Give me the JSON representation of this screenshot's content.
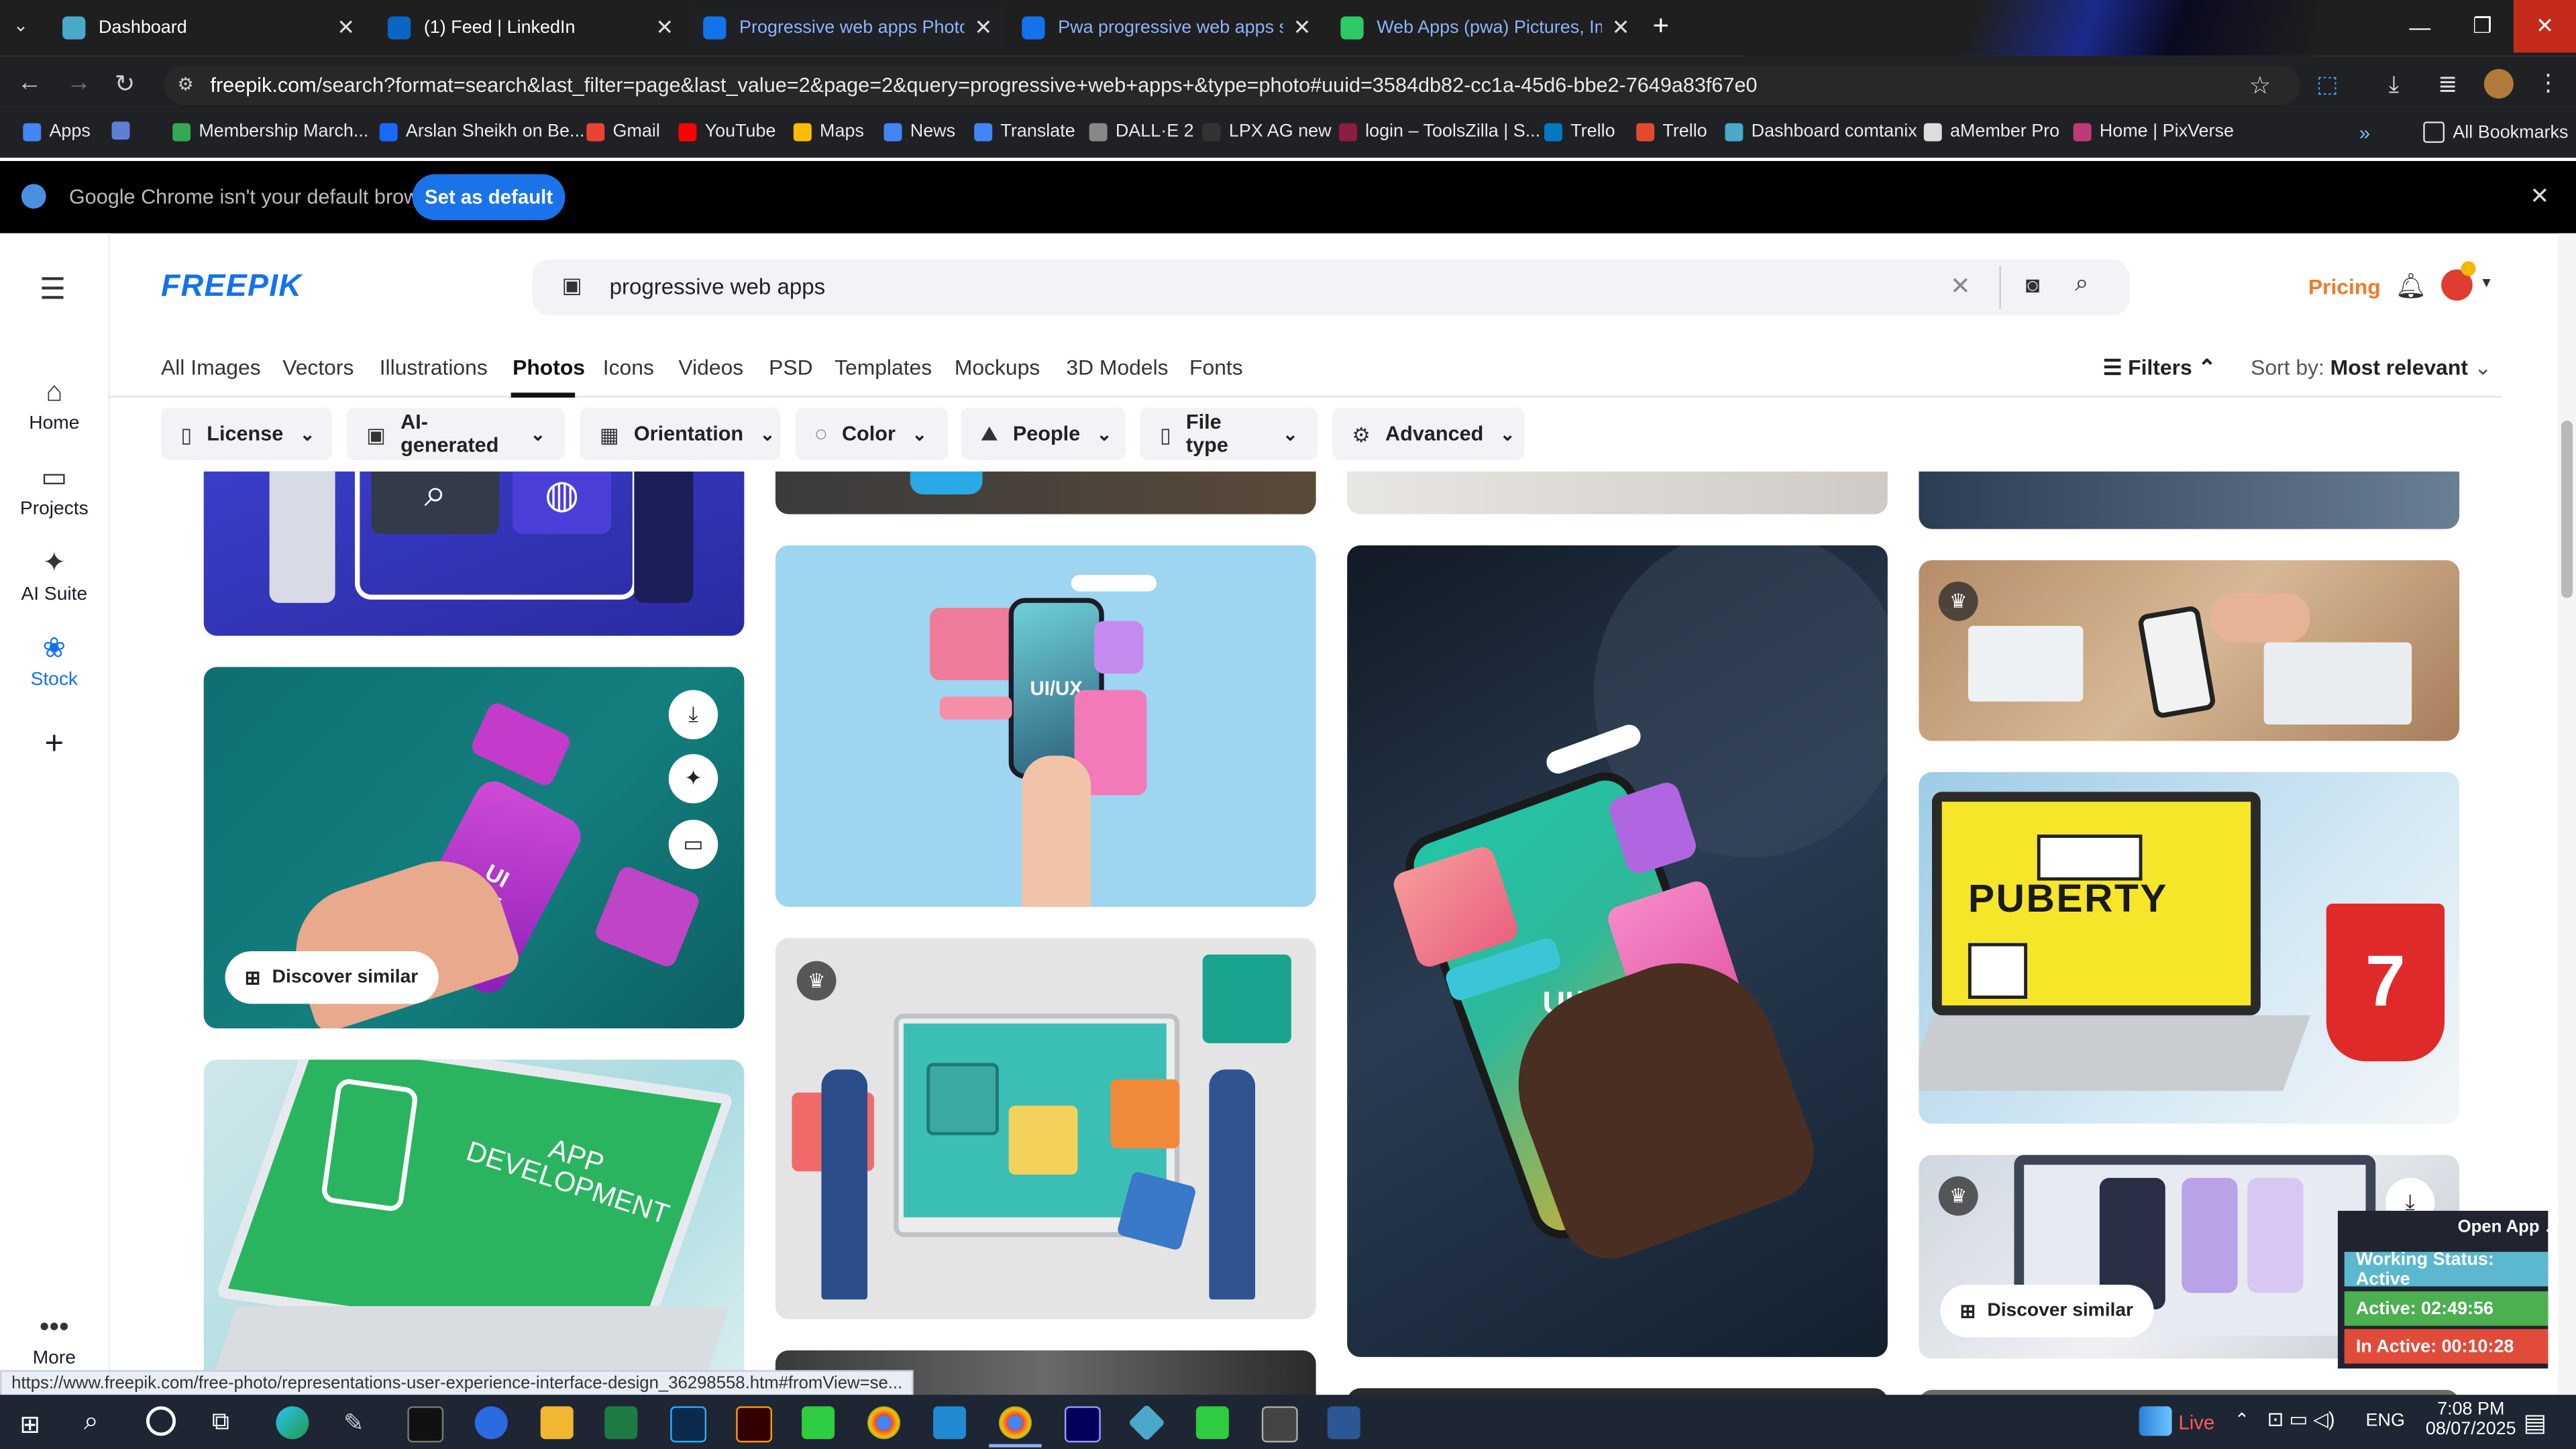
{
  "browser": {
    "tabs": [
      {
        "title": "Dashboard",
        "active": false,
        "color": "#4aa8c9"
      },
      {
        "title": "(1) Feed | LinkedIn",
        "active": false,
        "color": "#0a66c2"
      },
      {
        "title": "Progressive web apps Photos | ",
        "active": true,
        "color": "#1273eb"
      },
      {
        "title": "Pwa progressive web apps sma",
        "active": false,
        "color": "#1273eb"
      },
      {
        "title": "Web Apps (pwa) Pictures, Imag",
        "active": false,
        "color": "#2ec866"
      }
    ],
    "new_tab": "+",
    "url_host": "freepik.com",
    "url_path": "/search?format=search&last_filter=page&last_value=2&page=2&query=progressive+web+apps+&type=photo#uuid=3584db82-cc1a-45d6-bbe2-7649a83f67e0",
    "bookmarks": [
      {
        "label": "Apps",
        "color": "#4285f4"
      },
      {
        "label": "",
        "color": "#5f7fd6"
      },
      {
        "label": "Membership March...",
        "color": "#34a853"
      },
      {
        "label": "Arslan Sheikh on Be...",
        "color": "#1769ff"
      },
      {
        "label": "Gmail",
        "color": "#ea4335"
      },
      {
        "label": "YouTube",
        "color": "#ff0000"
      },
      {
        "label": "Maps",
        "color": "#fbbc04"
      },
      {
        "label": "News",
        "color": "#4285f4"
      },
      {
        "label": "Translate",
        "color": "#4285f4"
      },
      {
        "label": "DALL·E 2",
        "color": "#888888"
      },
      {
        "label": "LPX AG new",
        "color": "#333333"
      },
      {
        "label": "login – ToolsZilla | S...",
        "color": "#8b1e3f"
      },
      {
        "label": "Trello",
        "color": "#0079bf"
      },
      {
        "label": "Trello",
        "color": "#e04b2f"
      },
      {
        "label": "Dashboard comtanix",
        "color": "#4aa8c9"
      },
      {
        "label": "aMember Pro",
        "color": "#dddddd"
      },
      {
        "label": "Home | PixVerse",
        "color": "#c03a7a"
      }
    ],
    "all_bookmarks": "All Bookmarks",
    "info_message": "Google Chrome isn't your default browser",
    "set_default": "Set as default",
    "status_url": "https://www.freepik.com/free-photo/representations-user-experience-interface-design_36298558.htm#fromView=se..."
  },
  "freepik": {
    "logo": "FREEPIK",
    "search_value": "progressive web apps",
    "pricing": "Pricing",
    "rail": [
      {
        "label": "Home",
        "icon": "home-icon"
      },
      {
        "label": "Projects",
        "icon": "projects-icon"
      },
      {
        "label": "AI Suite",
        "icon": "ai-suite-icon"
      },
      {
        "label": "Stock",
        "icon": "stock-icon"
      },
      {
        "label": "More",
        "icon": "more-icon"
      }
    ],
    "categories": [
      "All Images",
      "Vectors",
      "Illustrations",
      "Photos",
      "Icons",
      "Videos",
      "PSD",
      "Templates",
      "Mockups",
      "3D Models",
      "Fonts"
    ],
    "selected_category": "Photos",
    "filters_label": "Filters",
    "sort_label": "Sort by:",
    "sort_value": "Most relevant",
    "filter_chips": [
      "License",
      "AI-generated",
      "Orientation",
      "Color",
      "People",
      "File type",
      "Advanced"
    ],
    "discover_similar": "Discover similar",
    "image_texts": {
      "uiux": "UI/UX",
      "ui": "UI",
      "ux": "UX",
      "app_dev_1": "APP",
      "app_dev_2": "DEVELOPMENT",
      "puberty": "PUBERTY",
      "seven": "7"
    }
  },
  "widget": {
    "open_app": "Open App ↗",
    "working_status": "Working Status: Active",
    "active": "Active: 02:49:56",
    "inactive": "In Active: 00:10:28"
  },
  "taskbar": {
    "live": "Live",
    "lang": "ENG",
    "time": "7:08 PM",
    "date": "08/07/2025"
  }
}
